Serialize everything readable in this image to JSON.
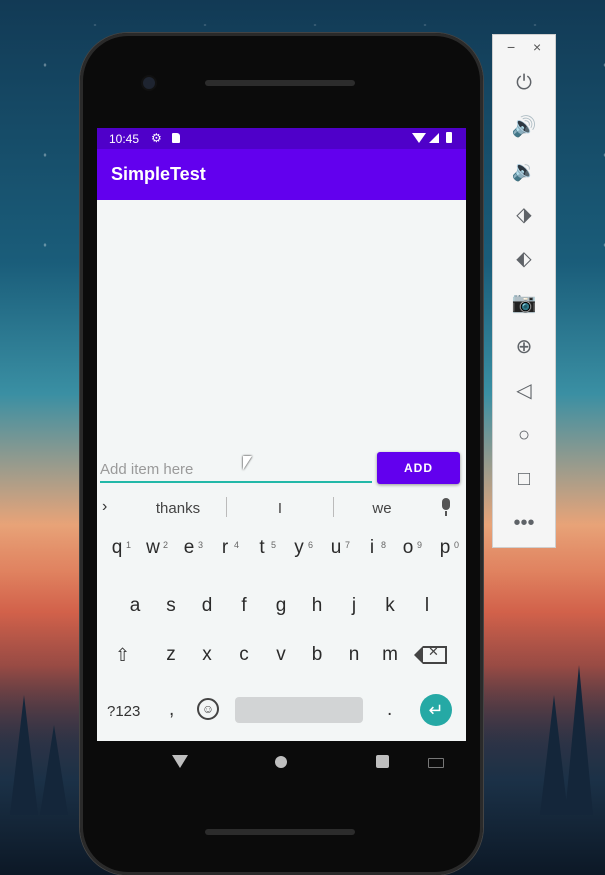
{
  "status_bar": {
    "time": "10:45"
  },
  "app": {
    "title": "SimpleTest"
  },
  "input": {
    "placeholder": "Add item here",
    "value": ""
  },
  "add_button": {
    "label": "ADD"
  },
  "keyboard": {
    "suggestions": [
      "thanks",
      "I",
      "we"
    ],
    "row1": [
      {
        "key": "q",
        "num": "1"
      },
      {
        "key": "w",
        "num": "2"
      },
      {
        "key": "e",
        "num": "3"
      },
      {
        "key": "r",
        "num": "4"
      },
      {
        "key": "t",
        "num": "5"
      },
      {
        "key": "y",
        "num": "6"
      },
      {
        "key": "u",
        "num": "7"
      },
      {
        "key": "i",
        "num": "8"
      },
      {
        "key": "o",
        "num": "9"
      },
      {
        "key": "p",
        "num": "0"
      }
    ],
    "row2": [
      "a",
      "s",
      "d",
      "f",
      "g",
      "h",
      "j",
      "k",
      "l"
    ],
    "row3": [
      "z",
      "x",
      "c",
      "v",
      "b",
      "n",
      "m"
    ],
    "symbols_key": "?123",
    "comma": ",",
    "period": "."
  },
  "icons": {
    "emulator_toolbar": [
      "power-icon",
      "volume-up-icon",
      "volume-down-icon",
      "rotate-left-icon",
      "rotate-right-icon",
      "camera-icon",
      "zoom-icon",
      "back-icon",
      "home-icon",
      "overview-icon",
      "more-icon"
    ]
  },
  "colors": {
    "primary": "#6200ee",
    "status_bar": "#4f00c9",
    "accent": "#22b8a8",
    "enter_key": "#25a9a5"
  }
}
